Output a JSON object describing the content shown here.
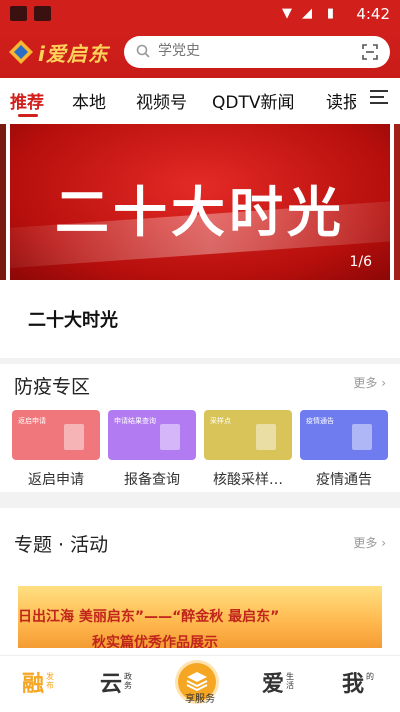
{
  "status_bar": {
    "time": "4:42"
  },
  "header": {
    "logo_text": "i爱启东",
    "search": {
      "placeholder": "学党史"
    }
  },
  "tabs": [
    {
      "label": "推荐",
      "active": true
    },
    {
      "label": "本地"
    },
    {
      "label": "视频号"
    },
    {
      "label": "QDTV新闻"
    },
    {
      "label": "读报"
    }
  ],
  "banner": {
    "title": "二十大时光",
    "pager": "1/6",
    "caption": "二十大时光"
  },
  "epidemic": {
    "title": "防疫专区",
    "more": "更多",
    "cards": [
      {
        "card_text": "返启申请",
        "label": "返启申请",
        "color": "#f0777b"
      },
      {
        "card_text": "申请结果查询",
        "label": "报备查询",
        "color": "#b37bf2"
      },
      {
        "card_text": "采样点",
        "label": "核酸采样…",
        "color": "#d9c45a"
      },
      {
        "card_text": "疫情通告",
        "label": "疫情通告",
        "color": "#6e7cf0"
      }
    ]
  },
  "topics": {
    "title": "专题 · 活动",
    "more": "更多",
    "promo_line1": "日出江海   美丽启东”——“醉金秋  最启东”",
    "promo_line2": "秋实篇优秀作品展示"
  },
  "bottom_nav": [
    {
      "big": "融",
      "small": "发布",
      "active": true
    },
    {
      "big": "云",
      "small": "政务"
    },
    {
      "label": "享服务"
    },
    {
      "big": "爱",
      "small": "生活"
    },
    {
      "big": "我",
      "small": "的"
    }
  ],
  "colors": {
    "brand_red": "#d1201c",
    "accent_orange": "#f5a623"
  }
}
